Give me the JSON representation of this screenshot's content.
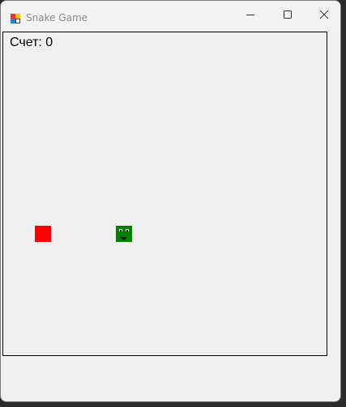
{
  "window": {
    "title": "Snake Game",
    "icons": {
      "app": "app-icon",
      "minimize": "minimize-icon",
      "maximize": "maximize-icon",
      "close": "close-icon"
    }
  },
  "game": {
    "score_text": "Счет: 0",
    "colors": {
      "food": "#ff0000",
      "snake": "#008000",
      "border": "#000000",
      "background": "#f0f0f0"
    }
  }
}
